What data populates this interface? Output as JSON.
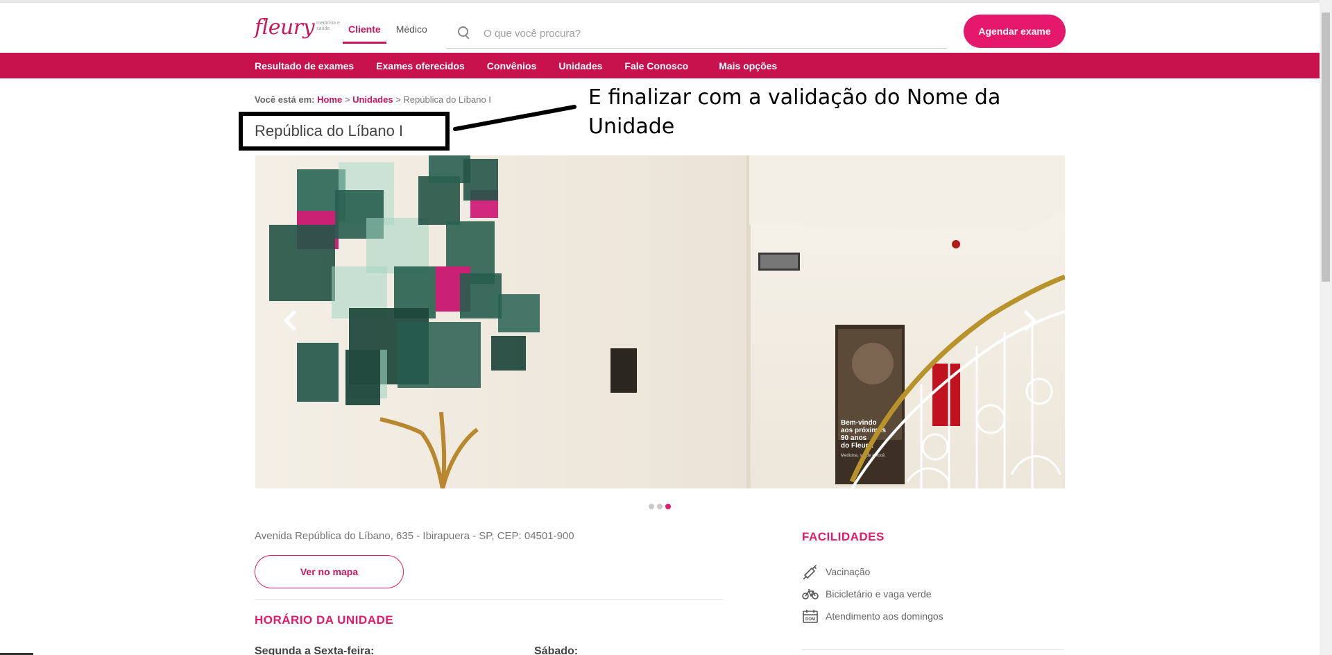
{
  "brand": {
    "name": "fleury",
    "tagline": "medicina e saúde",
    "accent": "#e5186b",
    "nav_bg": "#c8124e"
  },
  "audience_tabs": [
    {
      "label": "Cliente",
      "active": true
    },
    {
      "label": "Médico",
      "active": false
    }
  ],
  "search": {
    "placeholder": "O que você procura?",
    "value": "",
    "icon": "search-icon"
  },
  "cta": {
    "label": "Agendar exame"
  },
  "main_nav": [
    {
      "label": "Resultado de exames"
    },
    {
      "label": "Exames oferecidos"
    },
    {
      "label": "Convênios"
    },
    {
      "label": "Unidades"
    },
    {
      "label": "Fale Conosco"
    },
    {
      "label": "Mais opções"
    }
  ],
  "breadcrumb": {
    "prefix": "Você está em:",
    "items": [
      "Home",
      "Unidades",
      "República do Líbano I"
    ],
    "separator": ">"
  },
  "page_title": "República do Líbano I",
  "annotation": "E finalizar com a validação do Nome da Unidade",
  "carousel": {
    "slide_count": 3,
    "active_index": 2,
    "poster_text": [
      "Bem-vindo",
      "aos próximos",
      "90 anos",
      "do Fleury.",
      "Medicina, saúde e você."
    ],
    "prev_icon": "chevron-left-icon",
    "next_icon": "chevron-right-icon"
  },
  "address": "Avenida República do Líbano, 635 - Ibirapuera - SP, CEP: 04501-900",
  "map_button": "Ver no mapa",
  "hours": {
    "title": "HORÁRIO DA UNIDADE",
    "columns": [
      "Segunda a Sexta-feira:",
      "Sábado:"
    ]
  },
  "facilities": {
    "title": "FACILIDADES",
    "items": [
      {
        "label": "Vacinação",
        "icon": "syringe-icon"
      },
      {
        "label": "Bicicletário e vaga verde",
        "icon": "bicycle-icon"
      },
      {
        "label": "Atendimento aos domingos",
        "icon": "calendar-icon"
      }
    ]
  }
}
